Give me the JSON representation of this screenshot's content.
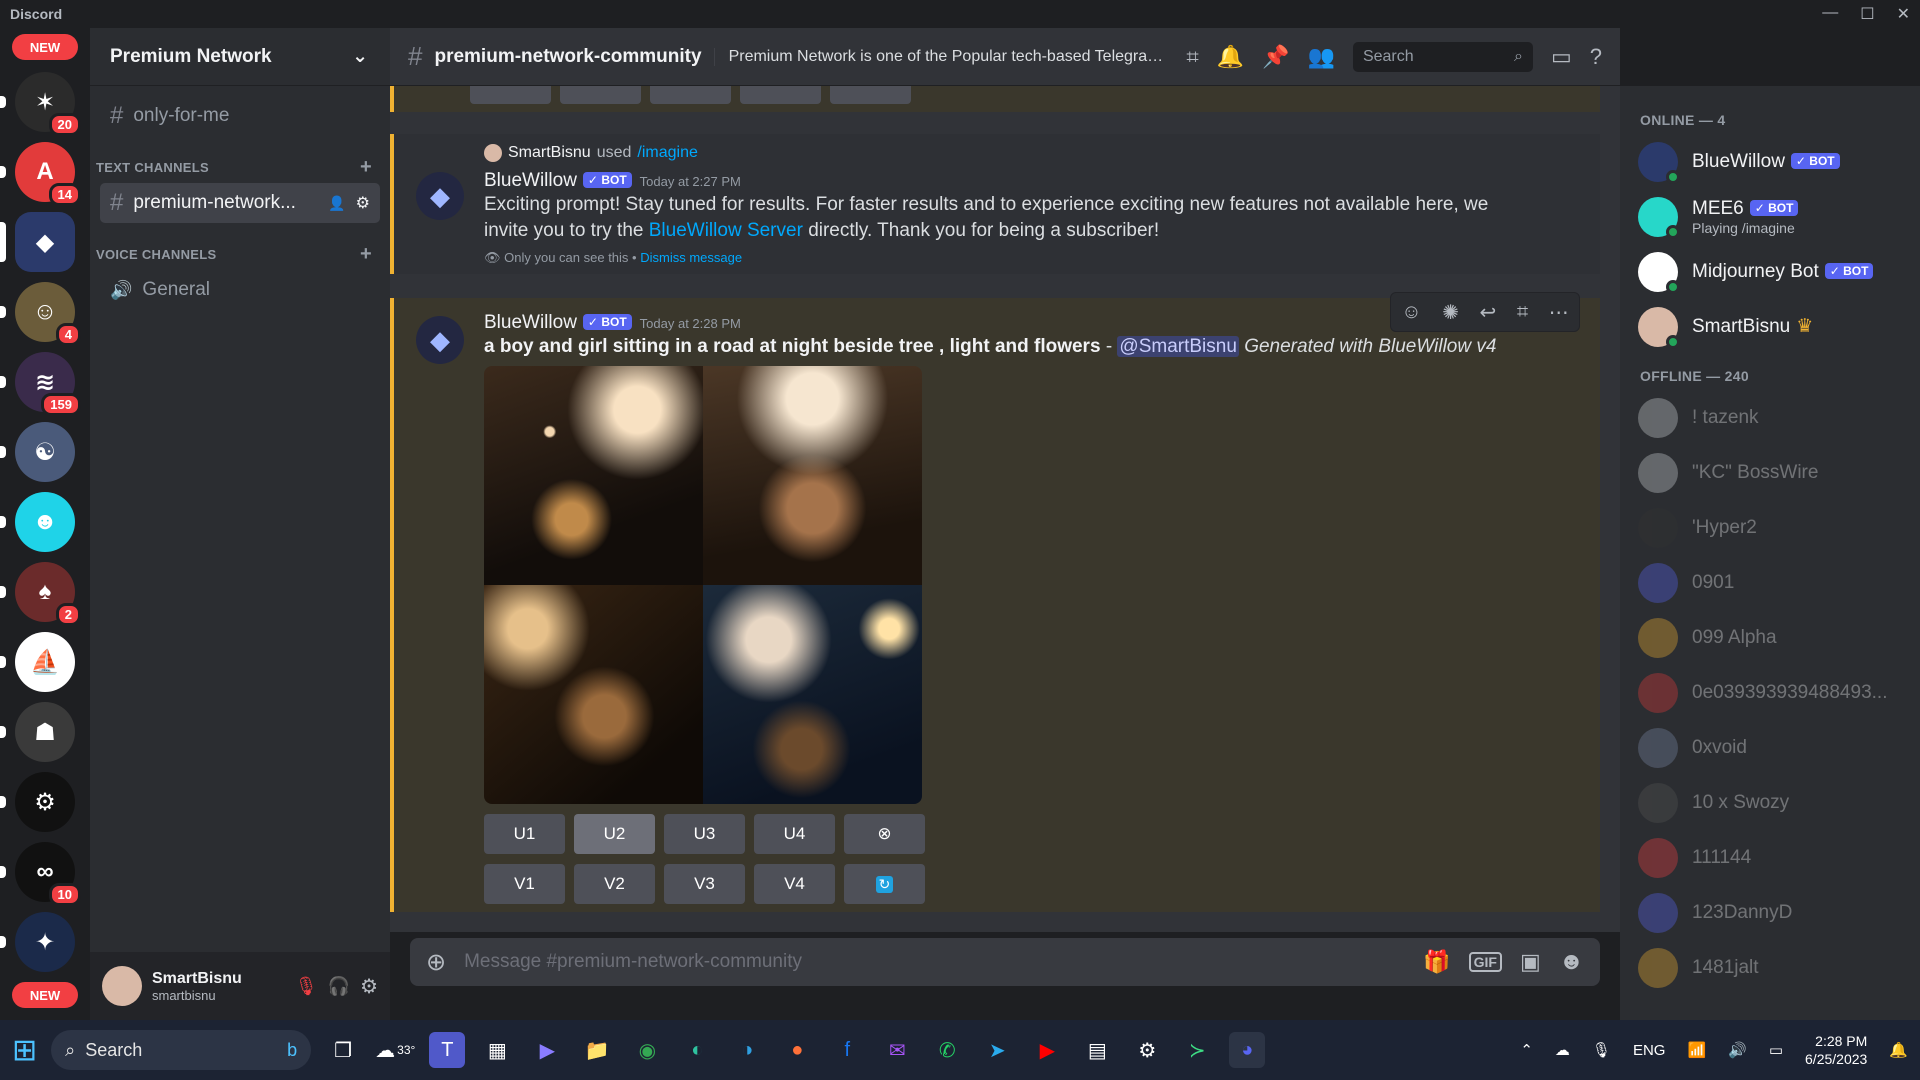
{
  "window": {
    "title": "Discord"
  },
  "servers": {
    "new_label": "NEW",
    "items": [
      {
        "icon": "server-icon-1",
        "badge": "20",
        "color": "#2b2b2b",
        "glyph": "✶"
      },
      {
        "icon": "server-icon-2",
        "badge": "14",
        "color": "#e23b3b",
        "glyph": "A"
      },
      {
        "icon": "bluewillow-server-icon",
        "badge": "",
        "color": "#2b3a6b",
        "glyph": "◆"
      },
      {
        "icon": "server-icon-4",
        "badge": "4",
        "color": "#6b5c3a",
        "glyph": "☺"
      },
      {
        "icon": "server-icon-5",
        "badge": "159",
        "color": "#3a2b4b",
        "glyph": "≋"
      },
      {
        "icon": "server-icon-6",
        "badge": "",
        "color": "#4a5a7a",
        "glyph": "☯"
      },
      {
        "icon": "server-icon-7",
        "badge": "",
        "color": "#1fd3e8",
        "glyph": "☻"
      },
      {
        "icon": "server-icon-8",
        "badge": "2",
        "color": "#6b2b2b",
        "glyph": "♠"
      },
      {
        "icon": "midjourney-server-icon",
        "badge": "",
        "color": "#ffffff",
        "glyph": "⛵"
      },
      {
        "icon": "server-icon-10",
        "badge": "",
        "color": "#3a3a3a",
        "glyph": "☗"
      },
      {
        "icon": "openai-server-icon",
        "badge": "",
        "color": "#111111",
        "glyph": "⚙"
      },
      {
        "icon": "server-icon-12",
        "badge": "10",
        "color": "#111111",
        "glyph": "∞"
      },
      {
        "icon": "server-icon-13",
        "badge": "",
        "color": "#1b2a4a",
        "glyph": "✦"
      }
    ],
    "new_label_bottom": "NEW"
  },
  "sidebar": {
    "guild_name": "Premium Network",
    "top_channel": "only-for-me",
    "text_category": "TEXT CHANNELS",
    "active_channel": "premium-network...",
    "voice_category": "VOICE CHANNELS",
    "voice_channel": "General"
  },
  "user_panel": {
    "display_name": "SmartBisnu",
    "username": "smartbisnu"
  },
  "header": {
    "channel_name": "premium-network-community",
    "topic": "Premium Network is one of the Popular tech-based Telegram Community .Our target ...",
    "search_placeholder": "Search"
  },
  "messages": {
    "first": {
      "reply_user": "SmartBisnu",
      "reply_used": "used",
      "reply_command": "/imagine",
      "author": "BlueWillow",
      "bot_tag": "BOT",
      "timestamp": "Today at 2:27 PM",
      "text_a": "Exciting prompt! Stay tuned for results. For faster results and to experience exciting new features not available here, we",
      "text_b": "invite you to try the",
      "text_link": "BlueWillow Server",
      "text_c": "directly. Thank you for being a subscriber!",
      "ephemeral": "Only you can see this •",
      "dismiss": "Dismiss message"
    },
    "second": {
      "author": "BlueWillow",
      "bot_tag": "BOT",
      "timestamp": "Today at 2:28 PM",
      "prompt": "a boy and girl sitting in a road at night beside tree , light and flowers",
      "separator": "-",
      "mention": "@SmartBisnu",
      "generated": "Generated with BlueWillow v4",
      "buttons_u": [
        "U1",
        "U2",
        "U3",
        "U4"
      ],
      "buttons_v": [
        "V1",
        "V2",
        "V3",
        "V4"
      ]
    }
  },
  "composer": {
    "placeholder": "Message #premium-network-community"
  },
  "members": {
    "online_header": "ONLINE — 4",
    "online": [
      {
        "name": "BlueWillow",
        "bot": "BOT",
        "activity": "",
        "color": "#2b3a6b"
      },
      {
        "name": "MEE6",
        "bot": "BOT",
        "activity": "Playing /imagine",
        "color": "#27d7c9"
      },
      {
        "name": "Midjourney Bot",
        "bot": "BOT",
        "activity": "",
        "color": "#ffffff"
      },
      {
        "name": "SmartBisnu",
        "bot": "",
        "activity": "",
        "color": "#d9b9a7"
      }
    ],
    "offline_header": "OFFLINE — 240",
    "offline": [
      {
        "name": "! tazenk",
        "color": "#cfd3d8"
      },
      {
        "name": "\"KC\" BossWire",
        "color": "#cfd3d8"
      },
      {
        "name": "'Hyper2",
        "color": "#333333"
      },
      {
        "name": "0901",
        "color": "#5865f2"
      },
      {
        "name": "099 Alpha",
        "color": "#f0b232"
      },
      {
        "name": "0e039393939488493...",
        "color": "#e23b3b"
      },
      {
        "name": "0xvoid",
        "color": "#7a8aa8"
      },
      {
        "name": "10 x Swozy",
        "color": "#555555"
      },
      {
        "name": "111144",
        "color": "#f23f43"
      },
      {
        "name": "123DannyD",
        "color": "#5865f2"
      },
      {
        "name": "1481jalt",
        "color": "#f0b232"
      }
    ]
  },
  "taskbar": {
    "search": "Search",
    "weather": "33°",
    "language": "ENG",
    "time": "2:28 PM",
    "date": "6/25/2023"
  }
}
